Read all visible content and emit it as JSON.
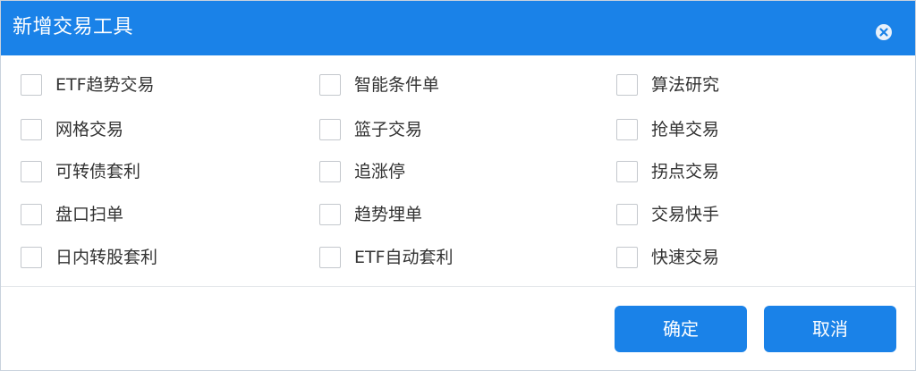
{
  "dialog": {
    "title": "新增交易工具",
    "close_icon": "close-circle-icon",
    "accent_color": "#1a82e8"
  },
  "options": {
    "col1": [
      {
        "label": "ETF趋势交易",
        "checked": false
      },
      {
        "label": "网格交易",
        "checked": false
      },
      {
        "label": "可转债套利",
        "checked": false
      },
      {
        "label": "盘口扫单",
        "checked": false
      },
      {
        "label": "日内转股套利",
        "checked": false
      }
    ],
    "col2": [
      {
        "label": "智能条件单",
        "checked": false
      },
      {
        "label": "篮子交易",
        "checked": false
      },
      {
        "label": "追涨停",
        "checked": false
      },
      {
        "label": "趋势埋单",
        "checked": false
      },
      {
        "label": "ETF自动套利",
        "checked": false
      }
    ],
    "col3": [
      {
        "label": "算法研究",
        "checked": false
      },
      {
        "label": "抢单交易",
        "checked": false
      },
      {
        "label": "拐点交易",
        "checked": false
      },
      {
        "label": "交易快手",
        "checked": false
      },
      {
        "label": "快速交易",
        "checked": false
      }
    ]
  },
  "buttons": {
    "confirm_label": "确定",
    "cancel_label": "取消"
  }
}
